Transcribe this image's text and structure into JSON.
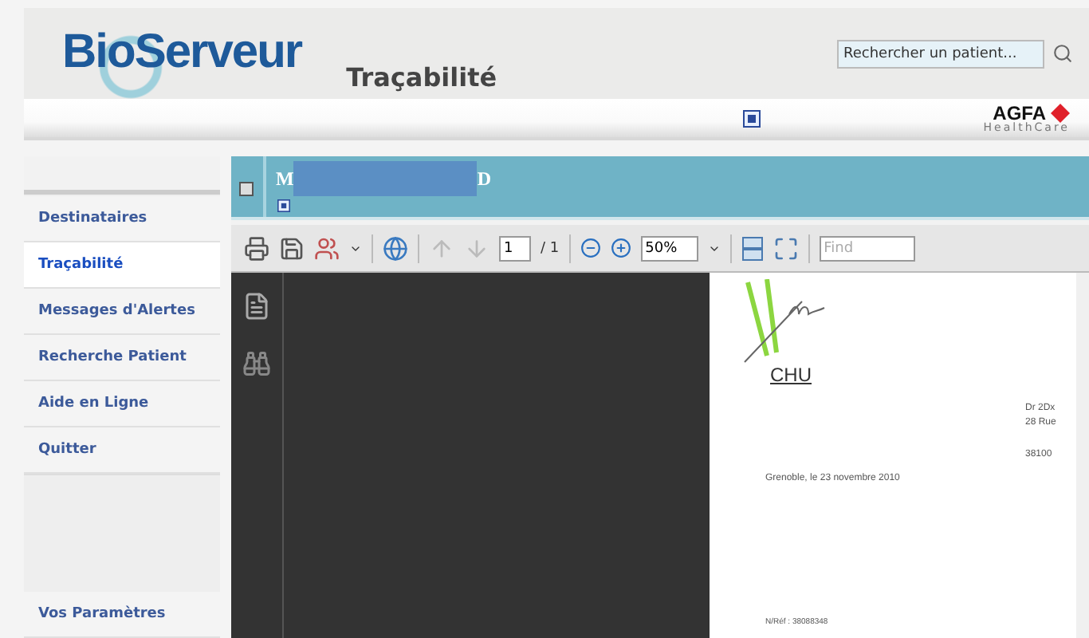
{
  "header": {
    "logo": "BioServeur",
    "title": "Traçabilité",
    "search": {
      "placeholder": "Rechercher un patient..."
    }
  },
  "brand": {
    "name": "AGFA",
    "sub": "HealthCare"
  },
  "sidebar": {
    "items": [
      {
        "label": "Destinataires",
        "selected": false
      },
      {
        "label": "Traçabilité",
        "selected": true
      },
      {
        "label": "Messages d'Alertes",
        "selected": false
      },
      {
        "label": "Recherche Patient",
        "selected": false
      },
      {
        "label": "Aide en Ligne",
        "selected": false
      },
      {
        "label": "Quitter",
        "selected": false
      }
    ],
    "footer_item": "Vos Paramètres"
  },
  "patient_bar": {
    "first": "M",
    "last": "D"
  },
  "toolbar": {
    "page": "1",
    "page_total": "/ 1",
    "zoom": "50%",
    "find": {
      "placeholder": "Find"
    }
  },
  "document": {
    "letterhead": "CHU",
    "address": [
      "Dr 2Dx",
      "28 Rue",
      "38100"
    ],
    "date": "Grenoble, le 23 novembre 2010",
    "reference": "N/Réf : 38088348"
  }
}
